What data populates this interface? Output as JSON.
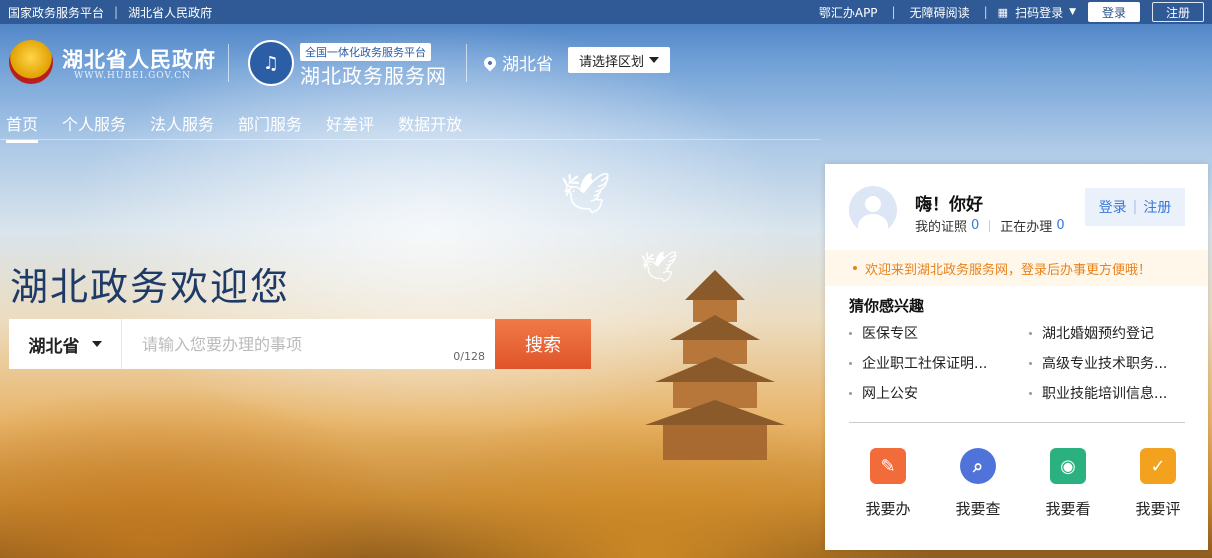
{
  "topbar": {
    "links_left": [
      "国家政务服务平台",
      "湖北省人民政府"
    ],
    "links_right": [
      "鄂汇办APP",
      "无障碍阅读",
      "扫码登录"
    ],
    "login": "登录",
    "register": "注册"
  },
  "header": {
    "gov_title": "湖北省人民政府",
    "gov_url": "WWW.HUBEI.GOV.CN",
    "service_tag": "全国一体化政务服务平台",
    "service_title": "湖北政务服务网",
    "location": "湖北省",
    "region_select": "请选择区划"
  },
  "nav": [
    "首页",
    "个人服务",
    "法人服务",
    "部门服务",
    "好差评",
    "数据开放"
  ],
  "hero": {
    "title": "湖北政务欢迎您",
    "province": "湖北省",
    "search_placeholder": "请输入您要办理的事项",
    "char_count": "0/128",
    "search_button": "搜索"
  },
  "panel": {
    "greeting": "嗨！你好",
    "my_certs_label": "我的证照",
    "my_certs_count": "0",
    "in_progress_label": "正在办理",
    "in_progress_count": "0",
    "login": "登录",
    "register": "注册",
    "notice": "欢迎来到湖北政务服务网，登录后办事更方便哦！",
    "guess_title": "猜你感兴趣",
    "guess_items": [
      "医保专区",
      "湖北婚姻预约登记",
      "企业职工社保证明...",
      "高级专业技术职务...",
      "网上公安",
      "职业技能培训信息..."
    ],
    "actions": [
      {
        "label": "我要办",
        "icon": "handle-icon",
        "color": "#f26b3a"
      },
      {
        "label": "我要查",
        "icon": "search-icon",
        "color": "#4f73d9"
      },
      {
        "label": "我要看",
        "icon": "view-icon",
        "color": "#2bb07f"
      },
      {
        "label": "我要评",
        "icon": "comment-icon",
        "color": "#f2a21e"
      }
    ]
  }
}
